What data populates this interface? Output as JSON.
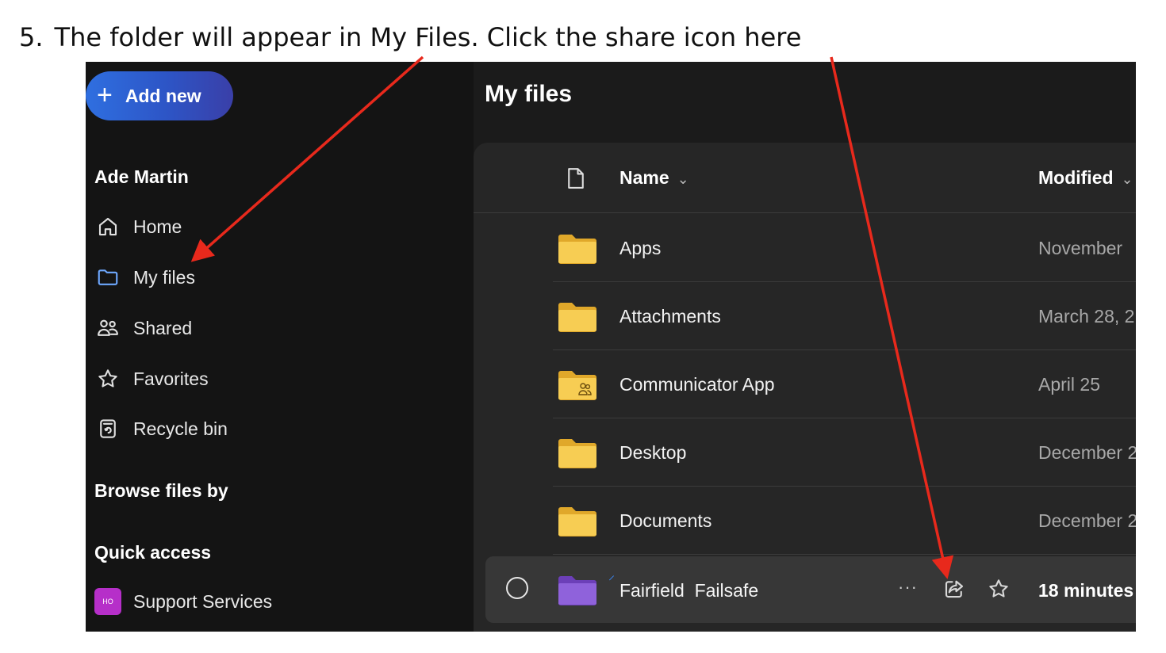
{
  "caption": {
    "number": "5.",
    "text": "The folder will appear in My Files. Click the share icon here"
  },
  "sidebar": {
    "add_new_label": "Add new",
    "user_name": "Ade Martin",
    "nav": [
      {
        "label": "Home",
        "icon": "home-icon"
      },
      {
        "label": "My files",
        "icon": "folder-icon",
        "active": true
      },
      {
        "label": "Shared",
        "icon": "people-icon"
      },
      {
        "label": "Favorites",
        "icon": "star-icon"
      },
      {
        "label": "Recycle bin",
        "icon": "recycle-bin-icon"
      }
    ],
    "browse_files_by": "Browse files by",
    "quick_access": "Quick access",
    "quick_access_items": [
      {
        "label": "Support Services",
        "badge_text": "HO"
      }
    ]
  },
  "main": {
    "title": "My files",
    "columns": {
      "name": "Name",
      "modified": "Modified"
    },
    "rows": [
      {
        "name": "Apps",
        "modified": "November",
        "folder_color": "#f5c541"
      },
      {
        "name": "Attachments",
        "modified": "March 28, 2",
        "folder_color": "#f5c541"
      },
      {
        "name": "Communicator App",
        "modified": "April 25",
        "folder_color": "#f5c541",
        "shared": true
      },
      {
        "name": "Desktop",
        "modified": "December 2",
        "folder_color": "#f5c541"
      },
      {
        "name": "Documents",
        "modified": "December 2",
        "folder_color": "#f5c541"
      }
    ],
    "selected_row": {
      "name": "Fairfield  Failsafe",
      "modified": "18 minutes",
      "folder_color": "#8a5fd6",
      "more_label": "···"
    }
  },
  "colors": {
    "annotation_arrow": "#e8291c",
    "accent": "#2f6fe0",
    "active_icon": "#6ea8ff"
  }
}
